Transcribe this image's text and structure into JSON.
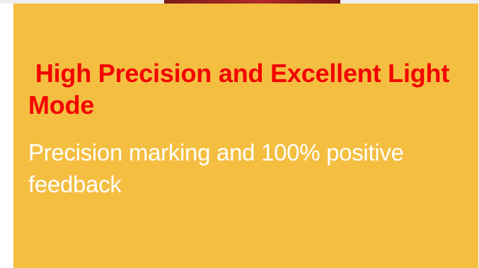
{
  "card": {
    "title": " High Precision and Excellent Light Mode",
    "subtitle": "Precision marking and 100% positive feedback"
  },
  "colors": {
    "page_background": "#ffffff",
    "card_background": "#f4be41",
    "title": "#f40000",
    "subtitle": "#ffffff",
    "image_accent": "#a62224"
  }
}
